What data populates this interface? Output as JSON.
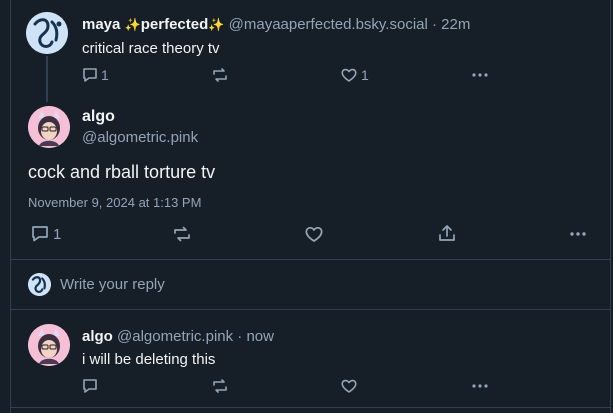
{
  "post_maya": {
    "display_name_1": "maya",
    "sparkle_1": "✨",
    "display_name_2": "perfected",
    "sparkle_2": "✨",
    "handle": "@mayaaperfected.bsky.social",
    "time": "· 22m",
    "text": "critical race theory tv",
    "reply_count": "1",
    "like_count": "1"
  },
  "post_algo": {
    "display_name": "algo",
    "handle": "@algometric.pink",
    "text": "cock and rball torture tv",
    "timestamp": "November 9, 2024 at 1:13 PM",
    "reply_count": "1"
  },
  "composer": {
    "placeholder": "Write your reply"
  },
  "reply_algo": {
    "display_name": "algo",
    "handle": "@algometric.pink",
    "time": "· now",
    "text": "i will be deleting this"
  },
  "icons": [
    "reply-icon",
    "repost-icon",
    "like-icon",
    "share-icon",
    "more-icon"
  ],
  "colors": {
    "background": "#161e27",
    "border": "#2e4052",
    "text": "#f1f3f5",
    "muted": "#93a5b7",
    "sparkle": "#f5c518"
  }
}
